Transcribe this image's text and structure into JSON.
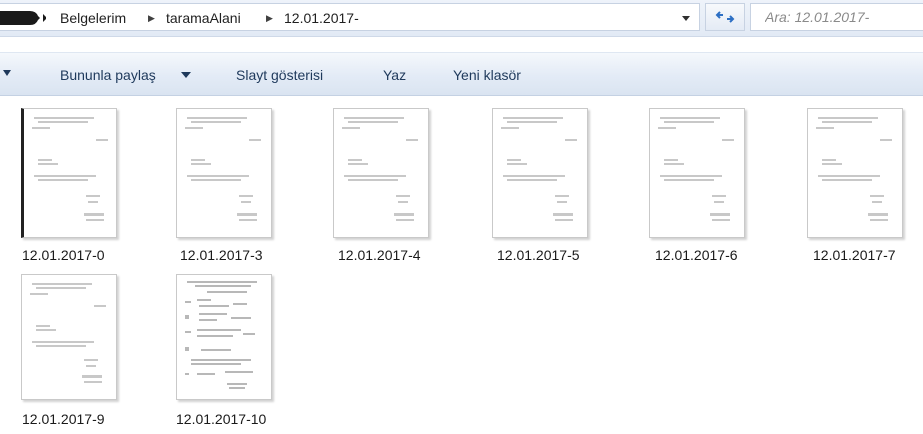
{
  "address_bar": {
    "breadcrumbs": [
      {
        "label": "Belgelerim"
      },
      {
        "label": "taramaAlani"
      },
      {
        "label": "12.01.2017-"
      }
    ],
    "folder_icon": "folder-icon",
    "dropdown_icon": "chevron-down-icon",
    "refresh_icon": "refresh-icon"
  },
  "search": {
    "placeholder": "Ara: 12.01.2017-"
  },
  "toolbar": {
    "items": [
      {
        "label": "Bununla paylaş"
      },
      {
        "label": "Slayt gösterisi"
      },
      {
        "label": "Yaz"
      },
      {
        "label": "Yeni klasör"
      }
    ]
  },
  "files": [
    {
      "name": "12.01.2017-0",
      "icon": "document-thumbnail"
    },
    {
      "name": "12.01.2017-3",
      "icon": "document-thumbnail"
    },
    {
      "name": "12.01.2017-4",
      "icon": "document-thumbnail"
    },
    {
      "name": "12.01.2017-5",
      "icon": "document-thumbnail"
    },
    {
      "name": "12.01.2017-6",
      "icon": "document-thumbnail"
    },
    {
      "name": "12.01.2017-7",
      "icon": "document-thumbnail"
    },
    {
      "name": "12.01.2017-9",
      "icon": "document-thumbnail"
    },
    {
      "name": "12.01.2017-10",
      "icon": "form-document-thumbnail"
    }
  ],
  "colors": {
    "toolbar_text": "#1e395b",
    "search_placeholder": "#8a8a8a",
    "frame_blue": "#e2eaf5"
  }
}
